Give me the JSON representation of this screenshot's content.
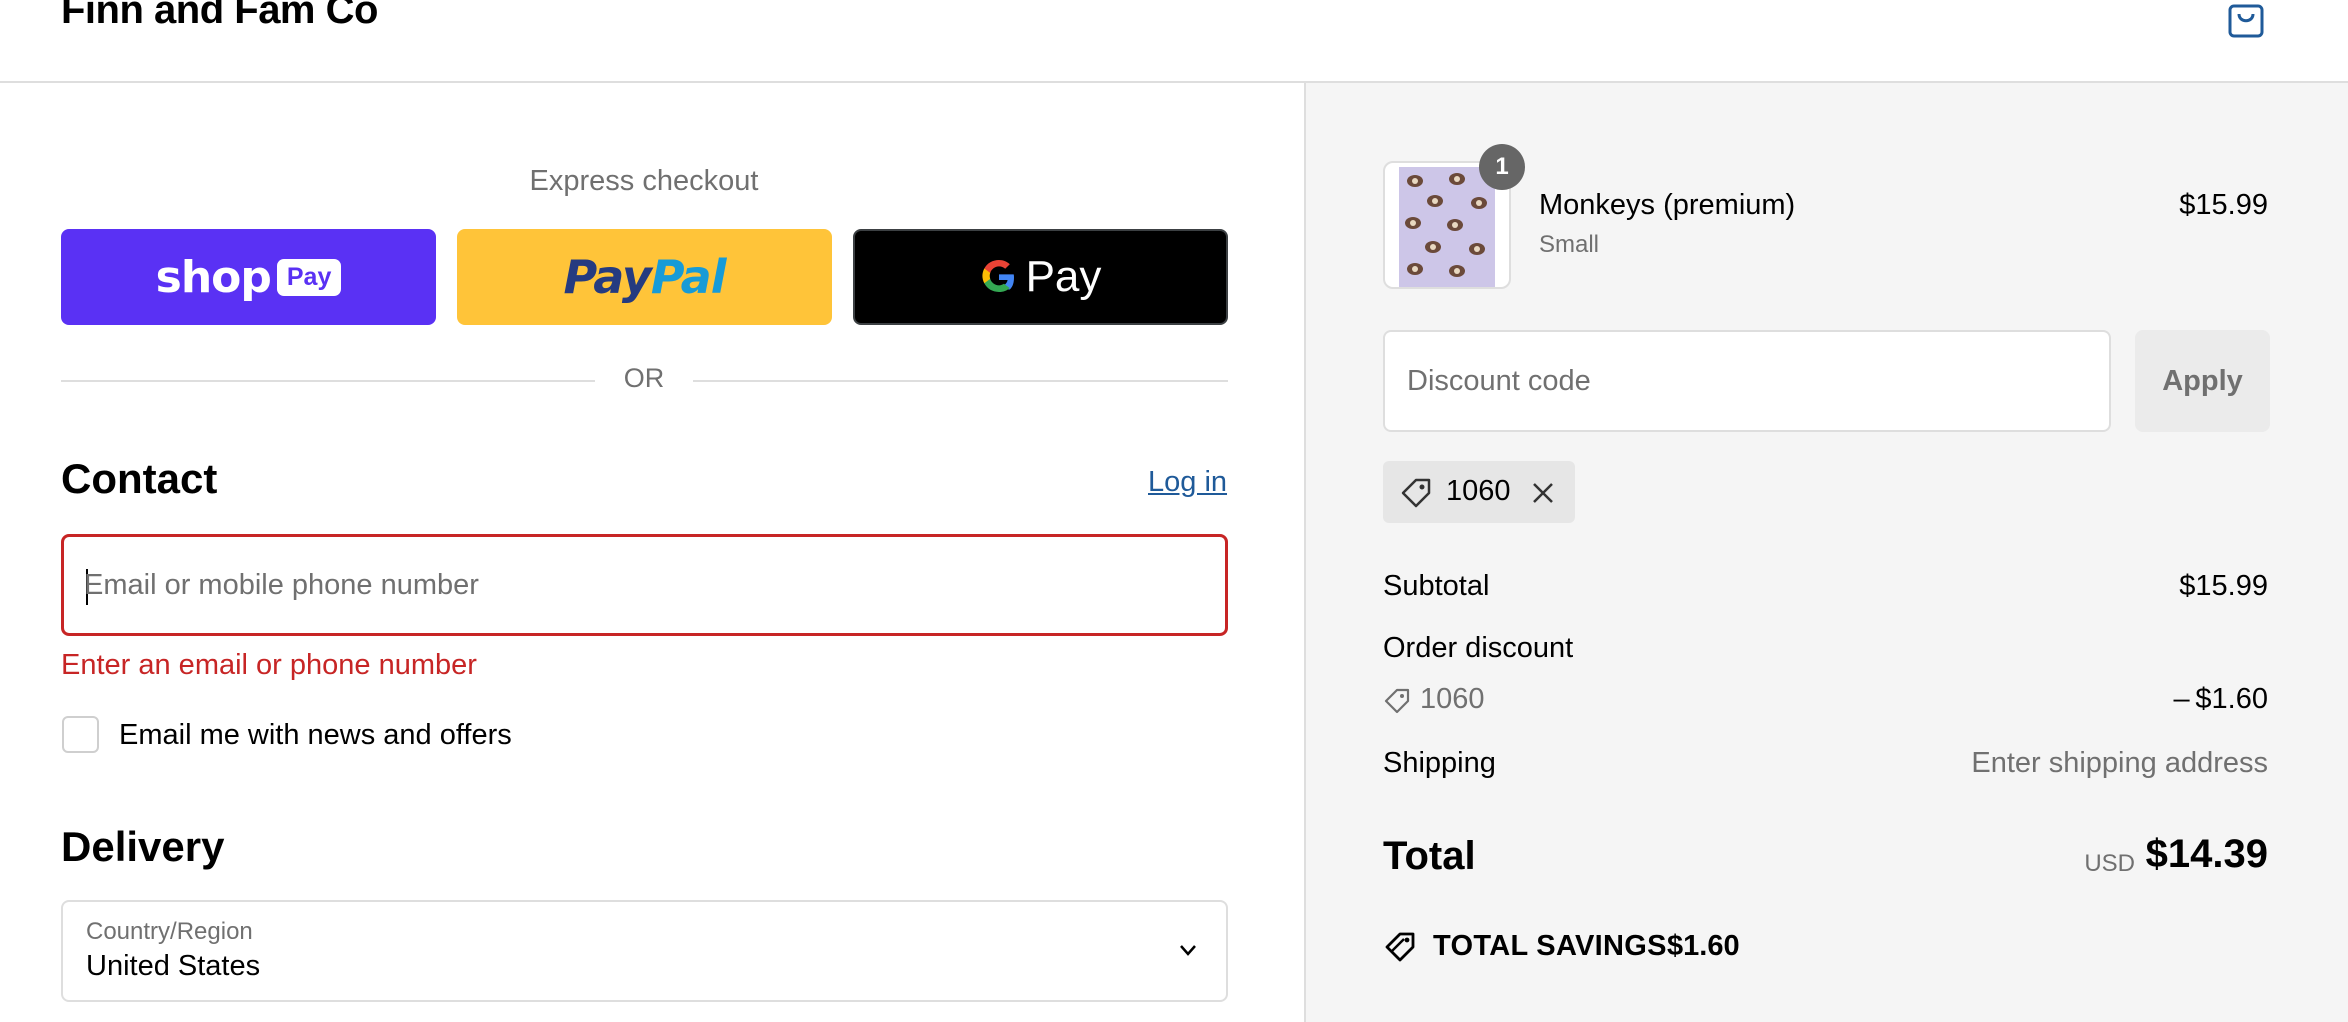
{
  "header": {
    "store_name": "Finn and Fam Co",
    "cart_icon": "shopping-bag-icon"
  },
  "express": {
    "title": "Express checkout",
    "shop_pay": {
      "word": "shop",
      "chip": "Pay",
      "color": "#5a31f4"
    },
    "paypal": {
      "part1": "Pay",
      "part2": "Pal",
      "color": "#ffc439"
    },
    "google_pay": {
      "word": "Pay",
      "color": "#000000"
    },
    "divider_text": "OR"
  },
  "contact": {
    "title": "Contact",
    "login_link": "Log in",
    "email_placeholder": "Email or mobile phone number",
    "email_value": "",
    "error_text": "Enter an email or phone number",
    "error_color": "#c72525",
    "newsletter_label": "Email me with news and offers",
    "newsletter_checked": false
  },
  "delivery": {
    "title": "Delivery",
    "country_label": "Country/Region",
    "country_value": "United States"
  },
  "summary": {
    "item": {
      "quantity": "1",
      "name": "Monkeys (premium)",
      "variant": "Small",
      "price": "$15.99"
    },
    "discount": {
      "placeholder": "Discount code",
      "apply_label": "Apply",
      "applied_code": "1060"
    },
    "subtotal_label": "Subtotal",
    "subtotal_value": "$15.99",
    "order_discount_label": "Order discount",
    "order_discount_code": "1060",
    "order_discount_value": "– $1.60",
    "shipping_label": "Shipping",
    "shipping_value": "Enter shipping address",
    "total_label": "Total",
    "total_currency": "USD",
    "total_value": "$14.39",
    "savings_label": "TOTAL SAVINGS",
    "savings_value": "$1.60"
  }
}
